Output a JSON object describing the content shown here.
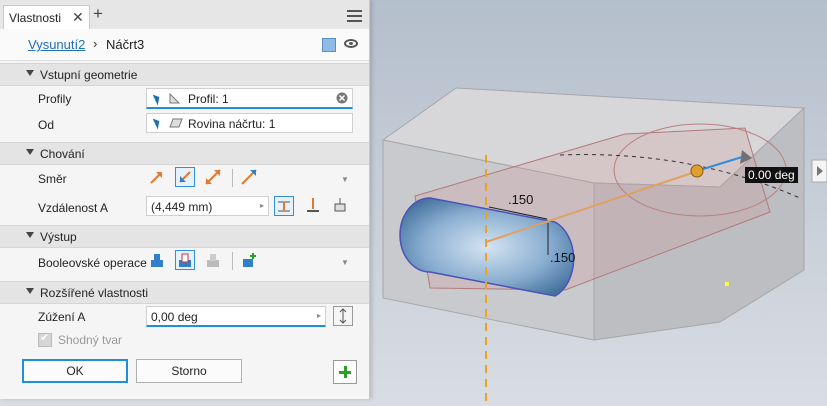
{
  "tab": {
    "label": "Vlastnosti"
  },
  "breadcrumb": {
    "parent": "Vysunutí2",
    "separator": "›",
    "current": "Náčrt3"
  },
  "sections": {
    "input_geometry": "Vstupní geometrie",
    "behavior": "Chování",
    "output": "Výstup",
    "advanced": "Rozšířené vlastnosti"
  },
  "fields": {
    "profiles_label": "Profily",
    "profiles_value": "Profil: 1",
    "from_label": "Od",
    "from_value": "Rovina náčrtu: 1",
    "direction_label": "Směr",
    "distance_label": "Vzdálenost A",
    "distance_value": "(4,449 mm)",
    "boolean_label": "Booleovské operace",
    "taper_label": "Zúžení A",
    "taper_value": "0,00 deg",
    "match_shape_label": "Shodný tvar"
  },
  "buttons": {
    "ok": "OK",
    "cancel": "Storno"
  },
  "viewport": {
    "angle_readout": "0.00 deg",
    "dim_1": ".150",
    "dim_2": ".150"
  },
  "colors": {
    "accent": "#1f8fd6",
    "link": "#1f6fb5",
    "add": "#2aa02a",
    "axis": "#f0a020"
  }
}
